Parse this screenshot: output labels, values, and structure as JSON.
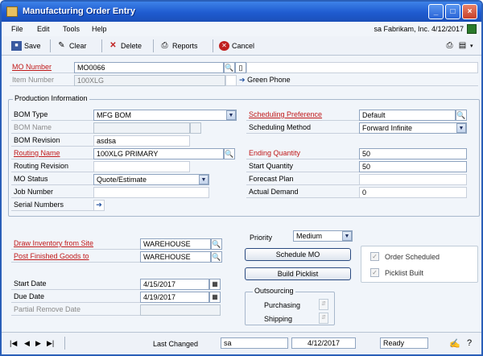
{
  "window": {
    "title": "Manufacturing Order Entry"
  },
  "menu": {
    "items": [
      "File",
      "Edit",
      "Tools",
      "Help"
    ],
    "user_info": "sa  Fabrikam, Inc.  4/12/2017"
  },
  "toolbar": {
    "save": "Save",
    "clear": "Clear",
    "delete": "Delete",
    "reports": "Reports",
    "cancel": "Cancel"
  },
  "header": {
    "mo_number_label": "MO Number",
    "mo_number": "MO0066",
    "item_number_label": "Item Number",
    "item_number": "100XLG",
    "item_description": "Green Phone"
  },
  "production": {
    "title": "Production Information",
    "bom_type_label": "BOM Type",
    "bom_type": "MFG BOM",
    "bom_name_label": "BOM Name",
    "bom_name": "",
    "bom_revision_label": "BOM Revision",
    "bom_revision": "asdsa",
    "routing_name_label": "Routing Name",
    "routing_name": "100XLG PRIMARY",
    "routing_revision_label": "Routing Revision",
    "routing_revision": "",
    "mo_status_label": "MO Status",
    "mo_status": "Quote/Estimate",
    "job_number_label": "Job Number",
    "job_number": "",
    "serial_numbers_label": "Serial Numbers",
    "scheduling_preference_label": "Scheduling Preference",
    "scheduling_preference": "Default",
    "scheduling_method_label": "Scheduling Method",
    "scheduling_method": "Forward Infinite",
    "ending_quantity_label": "Ending Quantity",
    "ending_quantity": "50",
    "start_quantity_label": "Start Quantity",
    "start_quantity": "50",
    "forecast_plan_label": "Forecast Plan",
    "forecast_plan": "",
    "actual_demand_label": "Actual Demand",
    "actual_demand": "0"
  },
  "sites": {
    "draw_label": "Draw Inventory from Site",
    "draw_site": "WAREHOUSE",
    "post_label": "Post Finished Goods to",
    "post_site": "WAREHOUSE"
  },
  "dates": {
    "start_label": "Start Date",
    "start": "4/15/2017",
    "due_label": "Due Date",
    "due": "4/19/2017",
    "partial_label": "Partial Remove Date",
    "partial": ""
  },
  "schedule": {
    "priority_label": "Priority",
    "priority": "Medium",
    "schedule_mo": "Schedule MO",
    "build_picklist": "Build Picklist",
    "order_scheduled": "Order Scheduled",
    "picklist_built": "Picklist Built"
  },
  "outsourcing": {
    "title": "Outsourcing",
    "purchasing": "Purchasing",
    "shipping": "Shipping"
  },
  "status": {
    "last_changed_label": "Last Changed",
    "user": "sa",
    "date": "4/12/2017",
    "state": "Ready"
  }
}
